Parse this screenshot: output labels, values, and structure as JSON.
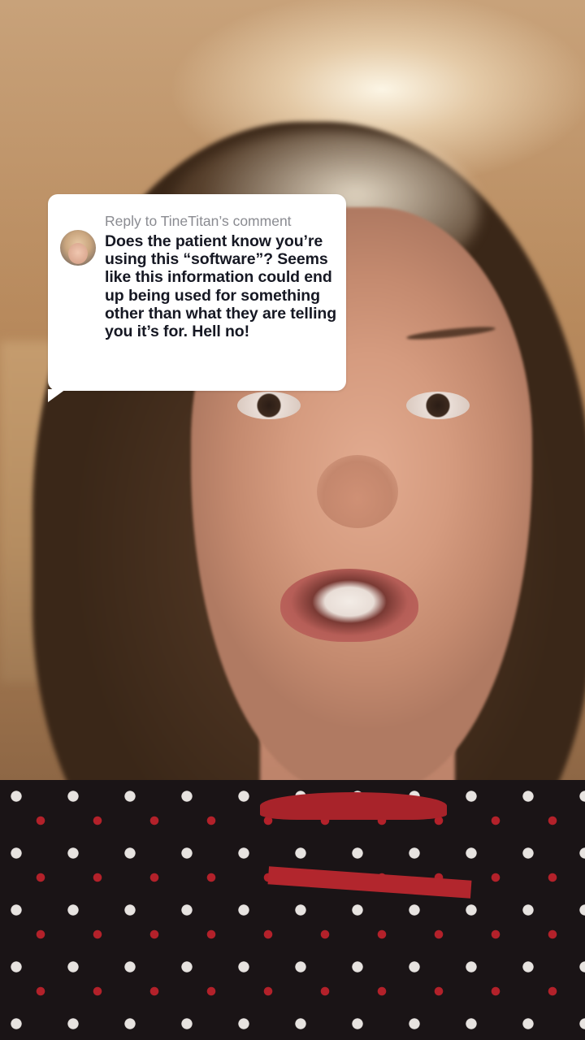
{
  "reply": {
    "header": "Reply to TineTitan’s comment",
    "avatar_icon": "commenter-avatar",
    "comment": "Does the patient know you’re using this “software”? Seems like this information could end up being used for something other than what they are telling you it’s for. Hell no!"
  },
  "colors": {
    "bubble_bg": "#ffffff",
    "header_text": "#8a8b91",
    "comment_text": "#161823"
  }
}
